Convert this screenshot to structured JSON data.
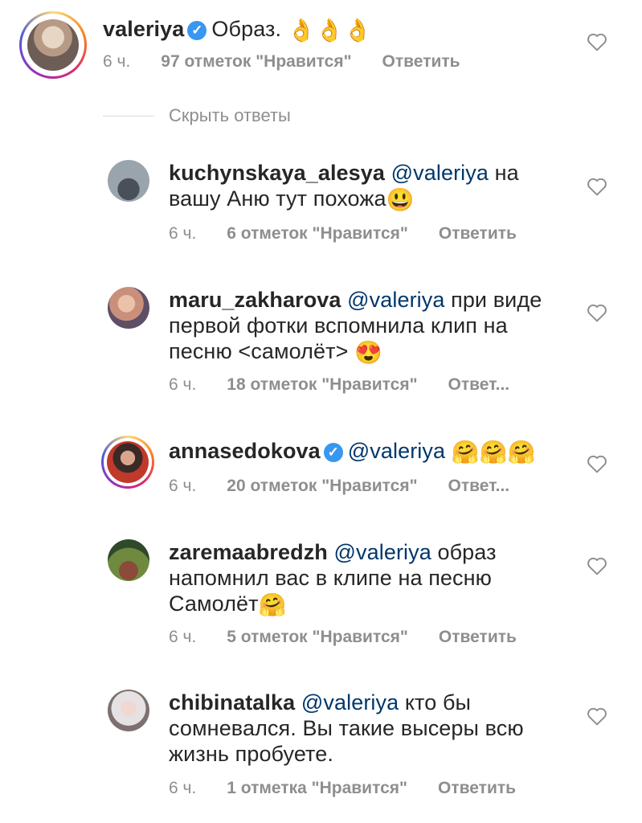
{
  "main_comment": {
    "username": "valeriya",
    "verified": true,
    "text": "Образ.",
    "emoji": "👌👌👌",
    "time": "6 ч.",
    "likes": "97 отметок \"Нравится\"",
    "reply": "Ответить"
  },
  "hide_replies": "Скрыть ответы",
  "replies": [
    {
      "username": "kuchynskaya_alesya",
      "mention": "@valeriya",
      "text": "на вашу Аню тут похожа",
      "emoji": "😃",
      "time": "6 ч.",
      "likes": "6 отметок \"Нравится\"",
      "reply": "Ответить"
    },
    {
      "username": "maru_zakharova",
      "mention": "@valeriya",
      "text": "при виде первой фотки вспомнила клип на песню <самолёт>",
      "emoji": "😍",
      "time": "6 ч.",
      "likes": "18 отметок \"Нравится\"",
      "reply": "Ответ..."
    },
    {
      "username": "annasedokova",
      "verified": true,
      "mention": "@valeriya",
      "text": "",
      "emoji": "🤗🤗🤗",
      "time": "6 ч.",
      "likes": "20 отметок \"Нравится\"",
      "reply": "Ответ..."
    },
    {
      "username": "zaremaabredzh",
      "mention": "@valeriya",
      "text": "образ напомнил вас в клипе на песню Самолёт",
      "emoji": "🤗",
      "time": "6 ч.",
      "likes": "5 отметок \"Нравится\"",
      "reply": "Ответить"
    },
    {
      "username": "chibinatalka",
      "mention": "@valeriya",
      "text": "кто бы сомневался. Вы такие высеры всю жизнь пробуете.",
      "emoji": "",
      "time": "6 ч.",
      "likes": "1 отметка \"Нравится\"",
      "reply": "Ответить"
    }
  ],
  "icons": {
    "like": "heart-outline-icon",
    "verified": "verified-badge-icon"
  },
  "colors": {
    "text": "#262626",
    "meta": "#8e8e8e",
    "mention": "#00376b",
    "verified": "#3897f0"
  }
}
